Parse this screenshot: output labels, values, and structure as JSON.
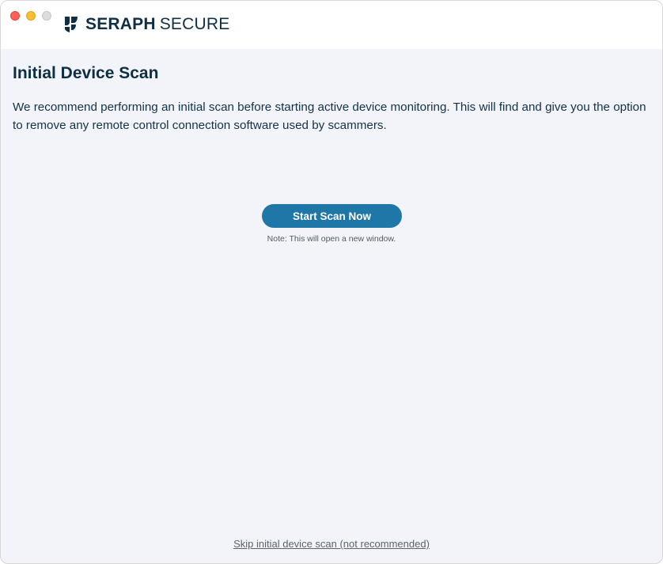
{
  "window": {
    "controls": [
      "close",
      "minimize",
      "zoom"
    ]
  },
  "brand": {
    "name_strong": "SERAPH",
    "name_light": "SECURE",
    "logo_icon": "seraph-wing-logo-icon"
  },
  "main": {
    "title": "Initial Device Scan",
    "description": "We recommend performing an initial scan before starting active device monitoring. This will find and give you the option to remove any remote control connection software used by scammers.",
    "scan_button_label": "Start Scan Now",
    "scan_note": "Note: This will open a new window.",
    "skip_link": "Skip initial device scan (not recommended)"
  },
  "colors": {
    "accent": "#1f77a8",
    "brand_text": "#102f45",
    "background": "#f3f4f9",
    "header_background": "#ffffff"
  }
}
